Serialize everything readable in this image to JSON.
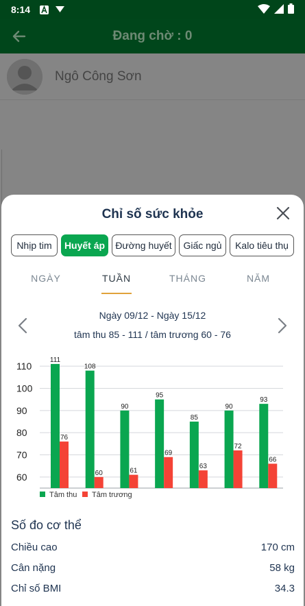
{
  "status_bar": {
    "time": "8:14",
    "icons": [
      "notification-a-icon",
      "download-icon",
      "wifi-icon",
      "signal-icon",
      "battery-icon"
    ]
  },
  "app_bar": {
    "title": "Đang chờ : 0",
    "back_icon": "arrow-left-icon"
  },
  "background_user": {
    "name": "Ngô Công Sơn"
  },
  "sheet": {
    "title": "Chỉ số sức khỏe",
    "close_icon": "close-icon",
    "tabs": [
      {
        "label": "Nhịp tim",
        "active": false
      },
      {
        "label": "Huyết áp",
        "active": true
      },
      {
        "label": "Đường huyết",
        "active": false
      },
      {
        "label": "Giấc ngủ",
        "active": false
      },
      {
        "label": "Kalo tiêu thụ",
        "active": false
      }
    ],
    "periods": [
      {
        "label": "NGÀY",
        "active": false
      },
      {
        "label": "TUẦN",
        "active": true
      },
      {
        "label": "THÁNG",
        "active": false
      },
      {
        "label": "NĂM",
        "active": false
      }
    ],
    "range": "Ngày 09/12 - Ngày 15/12",
    "summary": "tâm thu 85 - 111 / tâm trương 60 - 76"
  },
  "chart_data": {
    "type": "bar",
    "categories": [
      "",
      "",
      "",
      "",
      "",
      "",
      ""
    ],
    "series": [
      {
        "name": "Tâm thu",
        "color": "#0aa650",
        "values": [
          111,
          108,
          90,
          95,
          85,
          90,
          93
        ]
      },
      {
        "name": "Tâm trương",
        "color": "#f44336",
        "values": [
          76,
          60,
          61,
          69,
          63,
          72,
          66
        ]
      }
    ],
    "yticks": [
      60,
      70,
      80,
      90,
      100,
      110
    ],
    "ylim": [
      55,
      115
    ],
    "grid": true,
    "legend": "bottom-left"
  },
  "body_metrics": {
    "title": "Số đo cơ thể",
    "rows": [
      {
        "label": "Chiều cao",
        "value": "170 cm"
      },
      {
        "label": "Cân nặng",
        "value": "58 kg"
      },
      {
        "label": "Chỉ số BMI",
        "value": "34.3"
      }
    ]
  },
  "colors": {
    "primary": "#0aa650",
    "secondary": "#f44336",
    "app_bar": "#00461b",
    "accent_underline": "#e0a23a",
    "text": "#1e3350"
  }
}
